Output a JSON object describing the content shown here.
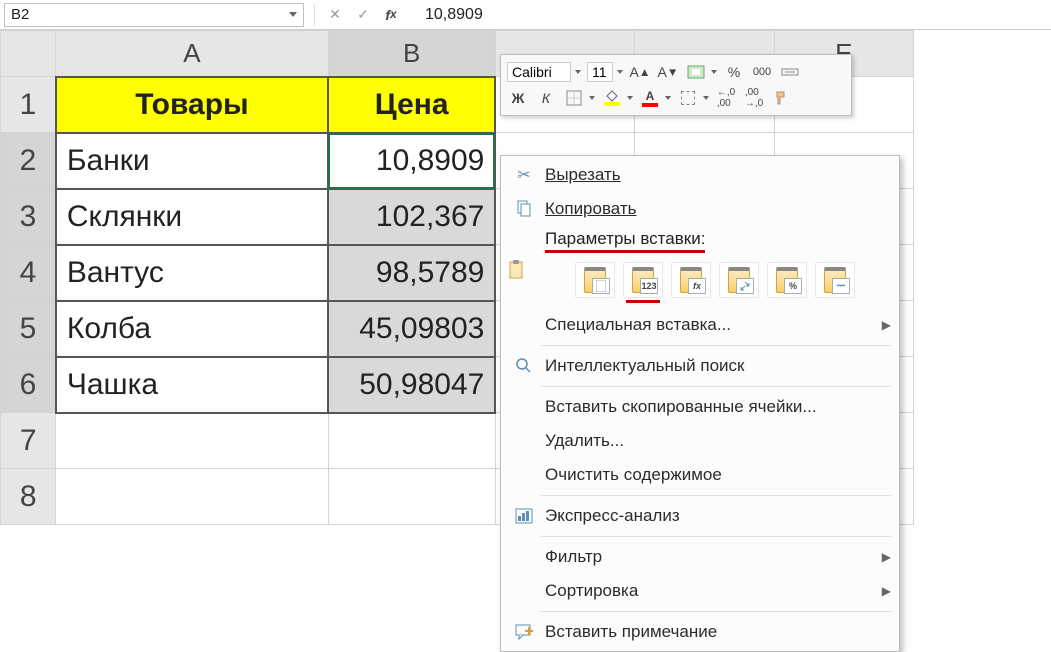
{
  "formula_bar": {
    "name_box": "B2",
    "value": "10,8909"
  },
  "mini_toolbar": {
    "font_name": "Calibri",
    "font_size": "11",
    "bold": "Ж",
    "italic": "К",
    "percent": "%",
    "thousands": "000",
    "inc_dec": ",0",
    "dec_inc": ",0"
  },
  "columns": {
    "A": "A",
    "B": "B",
    "E": "E"
  },
  "rows": [
    "1",
    "2",
    "3",
    "4",
    "5",
    "6",
    "7",
    "8"
  ],
  "headers": {
    "A": "Товары",
    "B": "Цена"
  },
  "cells": {
    "A2": "Банки",
    "B2": "10,8909",
    "A3": "Склянки",
    "B3": "102,367",
    "A4": "Вантус",
    "B4": "98,5789",
    "A5": "Колба",
    "B5": "45,09803",
    "A6": "Чашка",
    "B6": "50,98047"
  },
  "context_menu": {
    "cut": "Вырезать",
    "copy": "Копировать",
    "paste_options_header": "Параметры вставки:",
    "paste_123": "123",
    "paste_fx": "fx",
    "paste_pct": "%",
    "paste_special": "Специальная вставка...",
    "smart_lookup": "Интеллектуальный поиск",
    "insert_copied": "Вставить скопированные ячейки...",
    "delete": "Удалить...",
    "clear": "Очистить содержимое",
    "quick_analysis": "Экспресс-анализ",
    "filter": "Фильтр",
    "sort": "Сортировка",
    "insert_comment": "Вставить примечание"
  },
  "chart_data": {
    "type": "table",
    "title": "Товары / Цена",
    "columns": [
      "Товары",
      "Цена"
    ],
    "rows": [
      [
        "Банки",
        10.8909
      ],
      [
        "Склянки",
        102.367
      ],
      [
        "Вантус",
        98.5789
      ],
      [
        "Колба",
        45.09803
      ],
      [
        "Чашка",
        50.98047
      ]
    ]
  }
}
